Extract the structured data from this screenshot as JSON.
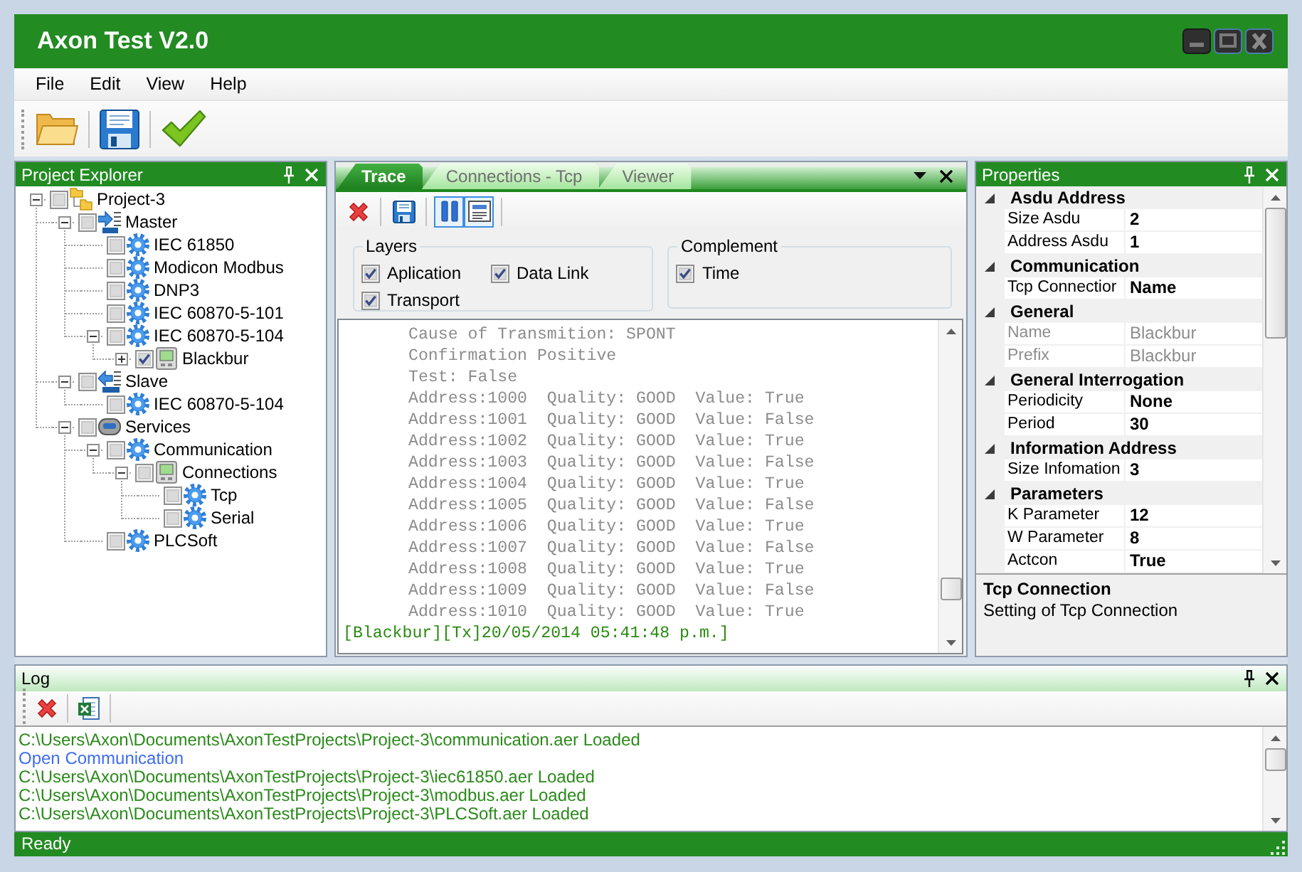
{
  "window": {
    "title": "Axon Test V2.0"
  },
  "menu": [
    "File",
    "Edit",
    "View",
    "Help"
  ],
  "project_explorer": {
    "title": "Project Explorer",
    "tree": [
      {
        "label": "Project-3",
        "kind": "project",
        "checked": false,
        "expanded": true,
        "children": [
          {
            "label": "Master",
            "kind": "master",
            "checked": false,
            "expanded": true,
            "children": [
              {
                "label": "IEC 61850",
                "kind": "gear",
                "checked": false
              },
              {
                "label": "Modicon Modbus",
                "kind": "gear",
                "checked": false
              },
              {
                "label": "DNP3",
                "kind": "gear",
                "checked": false
              },
              {
                "label": "IEC 60870-5-101",
                "kind": "gear",
                "checked": false
              },
              {
                "label": "IEC 60870-5-104",
                "kind": "gear",
                "checked": false,
                "expanded": true,
                "children": [
                  {
                    "label": "Blackbur",
                    "kind": "device",
                    "checked": true,
                    "expanded": false
                  }
                ]
              }
            ]
          },
          {
            "label": "Slave",
            "kind": "slave",
            "checked": false,
            "expanded": true,
            "children": [
              {
                "label": "IEC 60870-5-104",
                "kind": "gear",
                "checked": false
              }
            ]
          },
          {
            "label": "Services",
            "kind": "services",
            "checked": false,
            "expanded": true,
            "children": [
              {
                "label": "Communication",
                "kind": "gear",
                "checked": false,
                "expanded": true,
                "children": [
                  {
                    "label": "Connections",
                    "kind": "device",
                    "checked": false,
                    "expanded": true,
                    "children": [
                      {
                        "label": "Tcp",
                        "kind": "gear",
                        "checked": false
                      },
                      {
                        "label": "Serial",
                        "kind": "gear",
                        "checked": false
                      }
                    ]
                  }
                ]
              },
              {
                "label": "PLCSoft",
                "kind": "gear",
                "checked": false
              }
            ]
          }
        ]
      }
    ]
  },
  "trace": {
    "tabs": [
      {
        "label": "Trace",
        "selected": true
      },
      {
        "label": "Connections - Tcp",
        "selected": false
      },
      {
        "label": "Viewer",
        "selected": false
      }
    ],
    "toolbar": [
      {
        "kind": "clear",
        "on": false
      },
      {
        "kind": "save",
        "on": false
      },
      {
        "kind": "pause",
        "on": true
      },
      {
        "kind": "text-view",
        "on": true
      }
    ],
    "groups": [
      {
        "title": "Layers",
        "options": [
          {
            "label": "Aplication",
            "checked": true
          },
          {
            "label": "Data Link",
            "checked": true
          },
          {
            "label": "Transport",
            "checked": true
          }
        ]
      },
      {
        "title": "Complement",
        "options": [
          {
            "label": "Time",
            "checked": true
          }
        ]
      }
    ],
    "lines": [
      {
        "kind": "detail",
        "text": "Cause of Transmition: SPONT"
      },
      {
        "kind": "detail",
        "text": "Confirmation Positive"
      },
      {
        "kind": "detail",
        "text": "Test: False"
      },
      {
        "kind": "detail",
        "text": "Address:1000  Quality: GOOD  Value: True"
      },
      {
        "kind": "detail",
        "text": "Address:1001  Quality: GOOD  Value: False"
      },
      {
        "kind": "detail",
        "text": "Address:1002  Quality: GOOD  Value: True"
      },
      {
        "kind": "detail",
        "text": "Address:1003  Quality: GOOD  Value: False"
      },
      {
        "kind": "detail",
        "text": "Address:1004  Quality: GOOD  Value: True"
      },
      {
        "kind": "detail",
        "text": "Address:1005  Quality: GOOD  Value: False"
      },
      {
        "kind": "detail",
        "text": "Address:1006  Quality: GOOD  Value: True"
      },
      {
        "kind": "detail",
        "text": "Address:1007  Quality: GOOD  Value: False"
      },
      {
        "kind": "detail",
        "text": "Address:1008  Quality: GOOD  Value: True"
      },
      {
        "kind": "detail",
        "text": "Address:1009  Quality: GOOD  Value: False"
      },
      {
        "kind": "detail",
        "text": "Address:1010  Quality: GOOD  Value: True"
      },
      {
        "kind": "header",
        "text": "[Blackbur][Tx]20/05/2014 05:41:48 p.m.]"
      }
    ]
  },
  "properties": {
    "title": "Properties",
    "groups": [
      {
        "name": "Asdu Address",
        "expanded": true,
        "rows": [
          {
            "name": "Size Asdu",
            "value": "2",
            "disabled": false
          },
          {
            "name": "Address Asdu",
            "value": "1",
            "disabled": false
          }
        ]
      },
      {
        "name": "Communication",
        "expanded": true,
        "rows": [
          {
            "name": "Tcp Connectior",
            "value": "Name",
            "disabled": false
          }
        ]
      },
      {
        "name": "General",
        "expanded": true,
        "rows": [
          {
            "name": "Name",
            "value": "Blackbur",
            "disabled": true
          },
          {
            "name": "Prefix",
            "value": "Blackbur",
            "disabled": true
          }
        ]
      },
      {
        "name": "General Interrogation",
        "expanded": true,
        "rows": [
          {
            "name": "Periodicity",
            "value": "None",
            "disabled": false
          },
          {
            "name": "Period",
            "value": "30",
            "disabled": false
          }
        ]
      },
      {
        "name": "Information Address",
        "expanded": true,
        "rows": [
          {
            "name": "Size Infomation",
            "value": "3",
            "disabled": false
          }
        ]
      },
      {
        "name": "Parameters",
        "expanded": true,
        "rows": [
          {
            "name": "K Parameter",
            "value": "12",
            "disabled": false
          },
          {
            "name": "W Parameter",
            "value": "8",
            "disabled": false
          },
          {
            "name": "Actcon",
            "value": "True",
            "disabled": false
          }
        ]
      }
    ],
    "description": {
      "title": "Tcp Connection",
      "text": "Setting of Tcp Connection"
    }
  },
  "log": {
    "title": "Log",
    "lines": [
      {
        "text": "C:\\Users\\Axon\\Documents\\AxonTestProjects\\Project-3\\communication.aer Loaded",
        "color": "#2a8a1a"
      },
      {
        "text": "Open Communication",
        "color": "#3d6cf0"
      },
      {
        "text": "C:\\Users\\Axon\\Documents\\AxonTestProjects\\Project-3\\iec61850.aer Loaded",
        "color": "#2a8a1a"
      },
      {
        "text": "C:\\Users\\Axon\\Documents\\AxonTestProjects\\Project-3\\modbus.aer Loaded",
        "color": "#2a8a1a"
      },
      {
        "text": "C:\\Users\\Axon\\Documents\\AxonTestProjects\\Project-3\\PLCSoft.aer Loaded",
        "color": "#2a8a1a"
      }
    ]
  },
  "status_bar": {
    "text": "Ready"
  }
}
